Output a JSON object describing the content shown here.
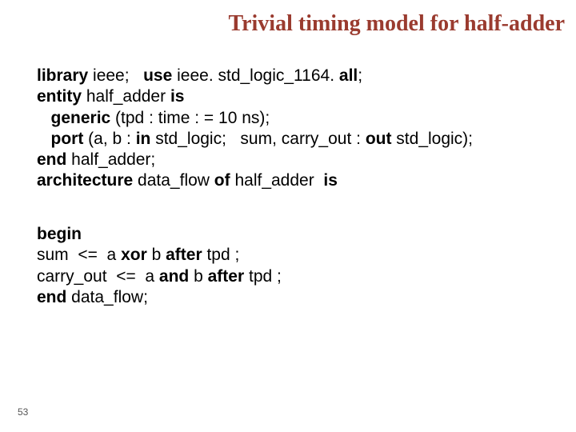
{
  "title": "Trivial timing model for half-adder",
  "code": {
    "kw_library": "library",
    "lib_name": " ieee;   ",
    "kw_use": "use",
    "use_rest": " ieee. std_logic_1164. ",
    "kw_all": "all",
    "semi": ";",
    "kw_entity": "entity",
    "ent_name": " half_adder ",
    "kw_is": "is",
    "indent1": "   ",
    "kw_generic": "generic",
    "gen_args": " (tpd : time : = 10 ns);",
    "kw_port": "port",
    "port_open": " (a, b : ",
    "kw_in": "in",
    "port_mid": " std_logic;   sum, carry_out : ",
    "kw_out": "out",
    "port_close": " std_logic);",
    "kw_end1": "end",
    "end1_rest": " half_adder;",
    "kw_arch": "architecture",
    "arch_name": " data_flow ",
    "kw_of": "of",
    "arch_ent": " half_adder  ",
    "kw_is2": "is",
    "kw_begin": "begin",
    "l_sum": "sum  <=  a ",
    "kw_xor": "xor",
    "sum_mid": " b ",
    "kw_after1": "after",
    "sum_rest": " tpd ;",
    "l_carry": "carry_out  <=  a ",
    "kw_and": "and",
    "carry_mid": " b ",
    "kw_after2": "after",
    "carry_rest": " tpd ;",
    "kw_end2": "end",
    "end2_rest": " data_flow;"
  },
  "page_number": "53"
}
